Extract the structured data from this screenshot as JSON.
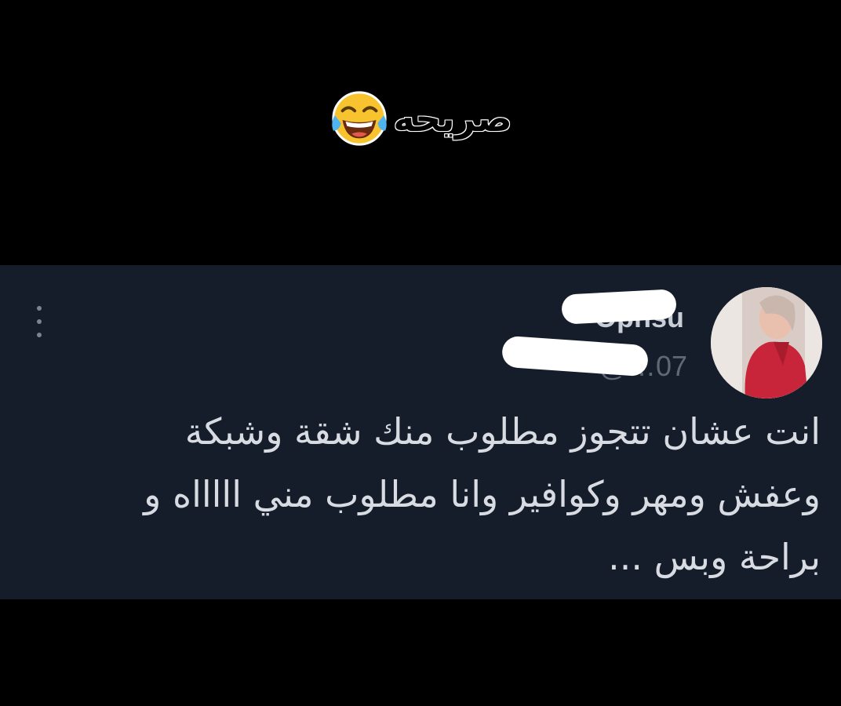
{
  "caption": {
    "text": "صريحه",
    "emoji": "face-with-tears-of-joy-icon"
  },
  "tweet": {
    "display_name": "Opnsu",
    "handle": "@…07",
    "text_lines": [
      "انت عشان تتجوز مطلوب منك شقة وشبكة",
      "وعفش ومهر وكوافير وانا مطلوب مني اااااه و",
      "براحة وبس ..."
    ]
  },
  "colors": {
    "background": "#000000",
    "card": "#151d2a",
    "text": "#d8dce2",
    "muted": "#5f6877"
  }
}
